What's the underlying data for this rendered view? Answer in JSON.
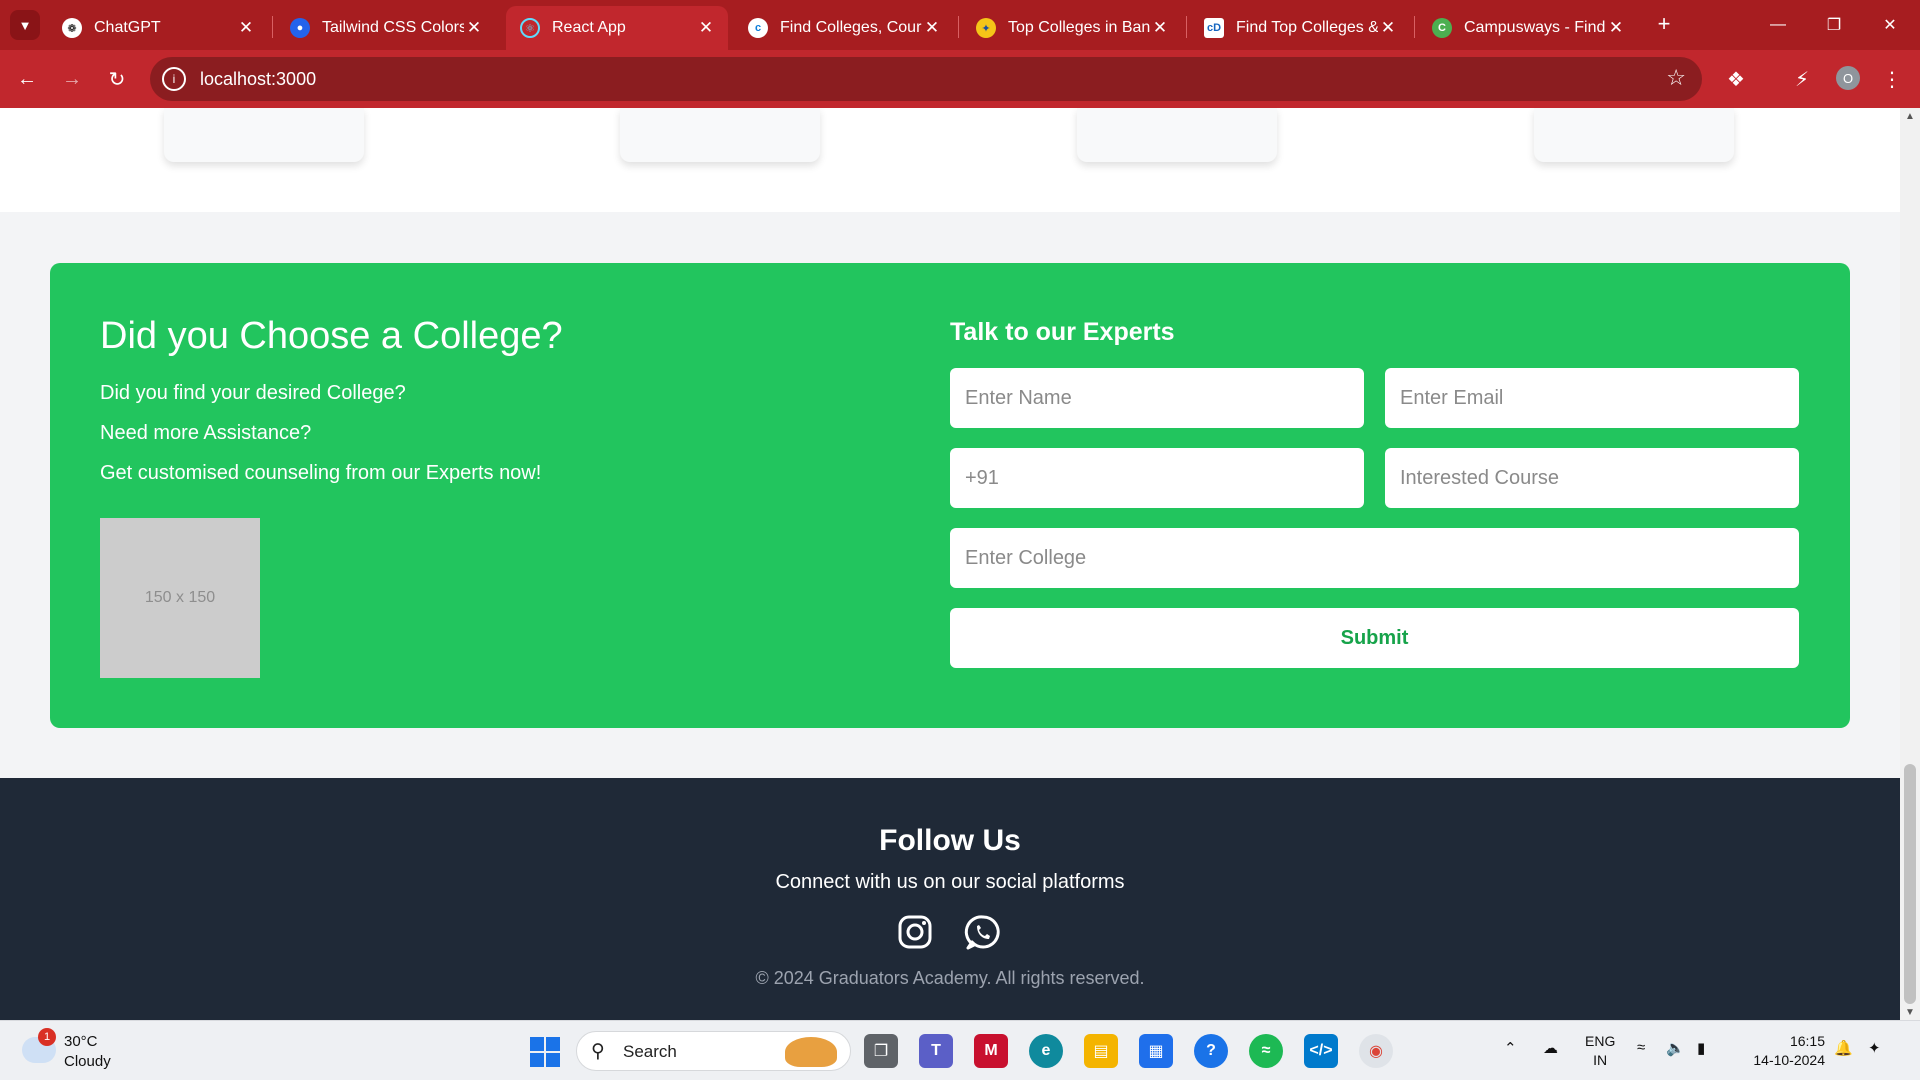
{
  "browser": {
    "tabs": [
      {
        "title": "ChatGPT",
        "favicon": "chatgpt-icon",
        "active": false
      },
      {
        "title": "Tailwind CSS Colors -",
        "favicon": "tailwind-icon",
        "active": false
      },
      {
        "title": "React App",
        "favicon": "react-icon",
        "active": true
      },
      {
        "title": "Find Colleges, Course",
        "favicon": "collegedunia-icon",
        "active": false
      },
      {
        "title": "Top Colleges in Bang",
        "favicon": "shiksha-icon",
        "active": false
      },
      {
        "title": "Find Top Colleges &",
        "favicon": "cd-icon",
        "active": false
      },
      {
        "title": "Campusways - Find C",
        "favicon": "campusways-icon",
        "active": false
      }
    ],
    "url": "localhost:3000",
    "profile_initial": "O"
  },
  "cta": {
    "title": "Did you Choose a College?",
    "lines": [
      "Did you find your desired College?",
      "Need more Assistance?",
      "Get customised counseling from our Experts now!"
    ],
    "image_placeholder": "150 x 150"
  },
  "form": {
    "title": "Talk to our Experts",
    "name_placeholder": "Enter Name",
    "email_placeholder": "Enter Email",
    "phone_placeholder": "+91",
    "course_placeholder": "Interested Course",
    "college_placeholder": "Enter College",
    "submit_label": "Submit"
  },
  "footer": {
    "title": "Follow Us",
    "subtitle": "Connect with us on our social platforms",
    "social": [
      "instagram-icon",
      "whatsapp-icon"
    ],
    "copyright": "© 2024 Graduators Academy. All rights reserved."
  },
  "taskbar": {
    "weather_temp": "30°C",
    "weather_condition": "Cloudy",
    "weather_badge": "1",
    "search_label": "Search",
    "lang_line1": "ENG",
    "lang_line2": "IN",
    "time": "16:15",
    "date": "14-10-2024"
  },
  "colors": {
    "chrome": "#c1272d",
    "cta_green": "#22c55e",
    "footer_bg": "#1f2937"
  }
}
